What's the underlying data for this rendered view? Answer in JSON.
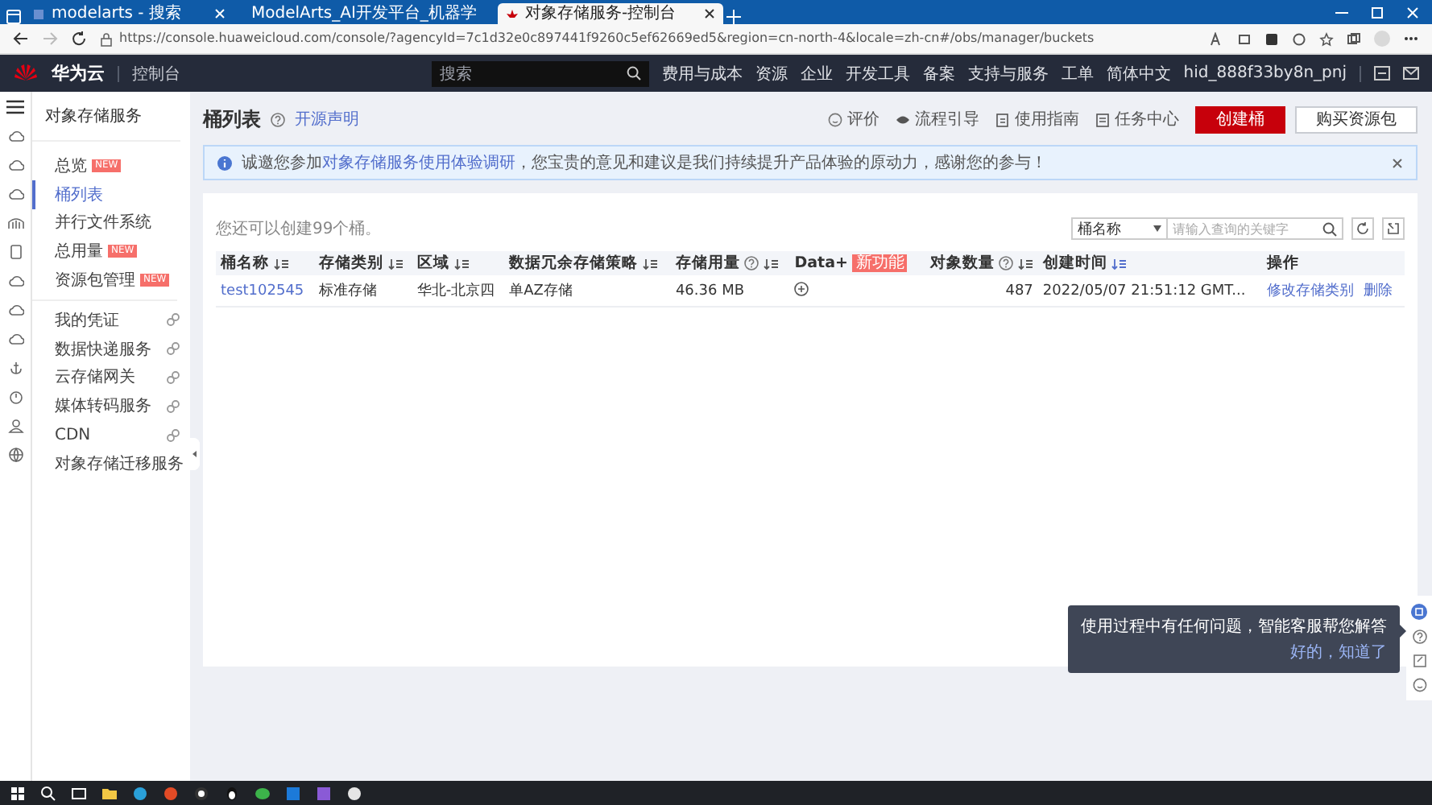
{
  "browser": {
    "tabs": [
      {
        "title": "modelarts - 搜索",
        "selected": false
      },
      {
        "title": "ModelArts_AI开发平台_机器学",
        "selected": false
      },
      {
        "title": "对象存储服务-控制台",
        "selected": true
      }
    ],
    "url": "https://console.huaweicloud.com/console/?agencyId=7c1d32e0c897441f9260c5ef62669ed5&region=cn-north-4&locale=zh-cn#/obs/manager/buckets"
  },
  "header": {
    "brand": "华为云",
    "console": "控制台",
    "search_placeholder": "搜索",
    "nav": [
      "费用与成本",
      "资源",
      "企业",
      "开发工具",
      "备案",
      "支持与服务",
      "工单",
      "简体中文"
    ],
    "user": "hid_888f33by8n_pnj"
  },
  "sidebar": {
    "title": "对象存储服务",
    "items": [
      {
        "label": "总览",
        "badge": "NEW",
        "kind": "page",
        "selected": false
      },
      {
        "label": "桶列表",
        "kind": "page",
        "selected": true
      },
      {
        "label": "并行文件系统",
        "kind": "page",
        "selected": false
      },
      {
        "label": "总用量",
        "badge": "NEW",
        "kind": "page",
        "selected": false
      },
      {
        "label": "资源包管理",
        "badge": "NEW",
        "kind": "page",
        "selected": false
      },
      {
        "label": "我的凭证",
        "kind": "link",
        "selected": false
      },
      {
        "label": "数据快递服务",
        "kind": "link",
        "selected": false
      },
      {
        "label": "云存储网关",
        "kind": "link",
        "selected": false
      },
      {
        "label": "媒体转码服务",
        "kind": "link",
        "selected": false
      },
      {
        "label": "CDN",
        "kind": "link",
        "selected": false
      },
      {
        "label": "对象存储迁移服务",
        "kind": "link",
        "selected": false
      }
    ]
  },
  "page": {
    "title": "桶列表",
    "notice_link": "开源声明",
    "actions": [
      {
        "label": "评价",
        "kind": "rate"
      },
      {
        "label": "流程引导",
        "kind": "guide"
      },
      {
        "label": "使用指南",
        "kind": "manual"
      },
      {
        "label": "任务中心",
        "kind": "tasks"
      }
    ],
    "create_button": "创建桶",
    "buy_button": "购买资源包",
    "banner": {
      "before": "诚邀您参加",
      "link": "对象存储服务使用体验调研",
      "after": "，您宝贵的意见和建议是我们持续提升产品体验的原动力，感谢您的参与！"
    },
    "quota": "您还可以创建99个桶。",
    "filter": {
      "field": "桶名称",
      "placeholder": "请输入查询的关键字"
    },
    "table": {
      "columns": [
        {
          "label": "桶名称",
          "kind": "link",
          "sortable": true,
          "sorted": false,
          "help": false
        },
        {
          "label": "存储类别",
          "kind": "text",
          "sortable": true,
          "sorted": false,
          "help": false
        },
        {
          "label": "区域",
          "kind": "text",
          "sortable": true,
          "sorted": false,
          "help": false
        },
        {
          "label": "数据冗余存储策略",
          "kind": "text",
          "sortable": true,
          "sorted": false,
          "help": false
        },
        {
          "label": "存储用量",
          "kind": "text",
          "sortable": true,
          "sorted": false,
          "help": true
        },
        {
          "label": "Data+",
          "badge": "新功能",
          "kind": "icon",
          "sortable": false,
          "help": false
        },
        {
          "label": "对象数量",
          "kind": "number",
          "sortable": true,
          "sorted": false,
          "help": true
        },
        {
          "label": "创建时间",
          "kind": "text",
          "sortable": true,
          "sorted": true,
          "help": false
        },
        {
          "label": "操作",
          "kind": "actions",
          "sortable": false,
          "help": false
        }
      ],
      "rows": [
        {
          "cells": [
            "test102545",
            "标准存储",
            "华北-北京四",
            "单AZ存储",
            "46.36 MB",
            "",
            "487",
            "2022/05/07 21:51:12 GMT...",
            [
              "修改存储类别",
              "删除"
            ]
          ]
        }
      ]
    }
  },
  "tooltip": {
    "text": "使用过程中有任何问题，智能客服帮您解答",
    "confirm": "好的，知道了"
  }
}
